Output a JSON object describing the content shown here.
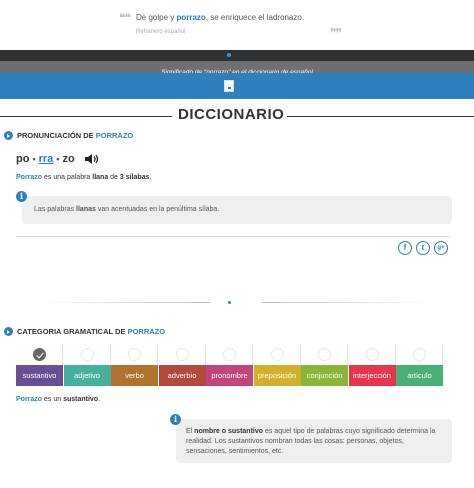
{
  "quote": {
    "text_before": "De golpe y ",
    "word": "porrazo",
    "text_after": ", se enriquece el ladronazo.",
    "source": "Refranero español"
  },
  "banner": {
    "subtitle": "Significado de \"porrazo\" en el diccionario de español"
  },
  "dictionary": {
    "title": "DICCIONARIO"
  },
  "pronunciation": {
    "heading_prefix": "PRONUNCIACIÓN DE ",
    "heading_word": "PORRAZO",
    "syllables": [
      "po",
      "rra",
      "zo"
    ],
    "separator": "•",
    "stressed_index": 1,
    "desc_word": "Porrazo",
    "desc_mid": " es una palabra ",
    "desc_type": "llana",
    "desc_de": " de ",
    "desc_count": "3 sílabas",
    "desc_end": ".",
    "info_before": "Las palabras ",
    "info_bold": "llanas",
    "info_after": " van acentuadas en la penúltima sílaba."
  },
  "social": {
    "facebook": "f",
    "twitter": "t",
    "googleplus": "g+"
  },
  "grammar": {
    "heading_prefix": "CATEGORIA GRAMATICAL DE ",
    "heading_word": "PORRAZO",
    "categories": [
      {
        "label": "sustantivo",
        "color": "#6b4f96",
        "selected": true
      },
      {
        "label": "adjetivo",
        "color": "#46b09d",
        "selected": false
      },
      {
        "label": "verbo",
        "color": "#b0732e",
        "selected": false
      },
      {
        "label": "adverbio",
        "color": "#b4493c",
        "selected": false
      },
      {
        "label": "pronombre",
        "color": "#c2457c",
        "selected": false
      },
      {
        "label": "preposición",
        "color": "#d1b02a",
        "selected": false
      },
      {
        "label": "conjunción",
        "color": "#8ab637",
        "selected": false
      },
      {
        "label": "interjección",
        "color": "#e8354f",
        "selected": false
      },
      {
        "label": "artículo",
        "color": "#4bb075",
        "selected": false
      }
    ],
    "desc_word": "Porrazo",
    "desc_mid": " es un ",
    "desc_type": "sustantivo",
    "desc_end": ".",
    "info_bold": "nombre o sustantivo",
    "info_before": "El ",
    "info_after": " es aquel tipo de palabras cuyo significado determina la realidad. Los sustantivos nombran todas las cosas: personas, objetos, sensaciones, sentimientos, etc."
  }
}
